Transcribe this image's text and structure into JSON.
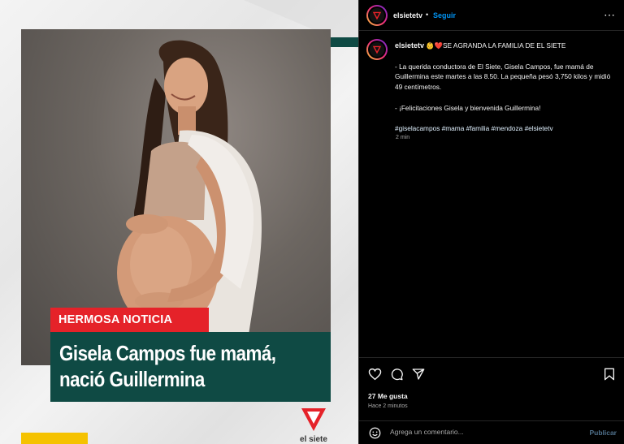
{
  "image": {
    "tag": "HERMOSA NOTICIA",
    "headline_line1": "Gisela Campos fue mamá,",
    "headline_line2": "nació Guillermina",
    "logo_text": "el siete",
    "colors": {
      "tag_red": "#e52229",
      "headline_teal": "#0f4a44",
      "strip_yellow": "#f5c200"
    }
  },
  "header": {
    "username": "elsietetv",
    "separator": "•",
    "follow_label": "Seguir",
    "more_icon": "more-horizontal-icon"
  },
  "caption": {
    "username": "elsietetv",
    "title": "👶❤️SE AGRANDA LA FAMILIA DE EL SIETE",
    "p1": "- La querida conductora de El Siete, Gisela Campos, fue mamá de Guillermina este martes a las 8.50. La pequeña pesó 3,750 kilos y midió 49 centímetros.",
    "p2": "- ¡Felicitaciones Gisela y bienvenida Guillermina!",
    "hashtags": "#giselacampos #mama #familia #mendoza #elsietetv",
    "time": "2 min"
  },
  "actions": {
    "icons": [
      "heart-icon",
      "comment-icon",
      "share-icon",
      "bookmark-icon"
    ],
    "likes": "27 Me gusta",
    "ago": "Hace 2 minutos"
  },
  "comment": {
    "placeholder": "Agrega un comentario...",
    "publish_label": "Publicar",
    "emoji_icon": "emoji-icon"
  }
}
